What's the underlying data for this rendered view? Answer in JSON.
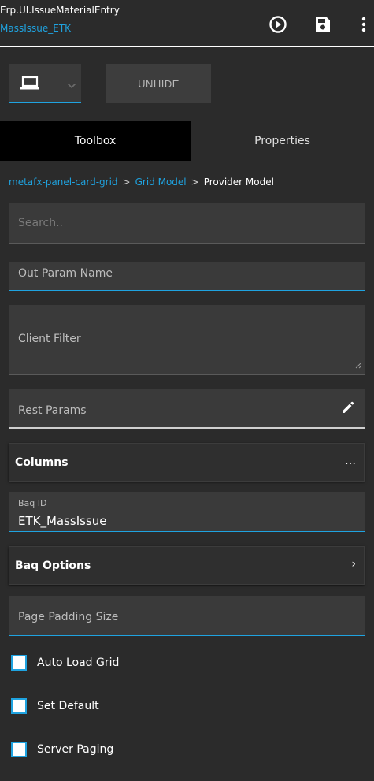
{
  "header": {
    "title": "Erp.UI.IssueMaterialEntry",
    "subtitle": "MassIssue_ETK",
    "icons": [
      "play-circle-icon",
      "save-icon",
      "more-vert-icon"
    ]
  },
  "toolbar": {
    "device": "laptop-icon",
    "unhide_label": "UNHIDE"
  },
  "tabs": [
    {
      "label": "Toolbox",
      "active": true
    },
    {
      "label": "Properties",
      "active": false
    }
  ],
  "breadcrumb": {
    "items": [
      "metafx-panel-card-grid",
      "Grid Model",
      "Provider Model"
    ],
    "separator": ">"
  },
  "search": {
    "placeholder": "Search.."
  },
  "fields": {
    "out_param_name": "Out Param Name",
    "client_filter": "Client Filter",
    "rest_params": "Rest Params",
    "page_padding_size": "Page Padding Size"
  },
  "sections": {
    "columns": {
      "label": "Columns",
      "trail": "…"
    },
    "baq_options": {
      "label": "Baq Options",
      "trail": "›"
    }
  },
  "baq_id": {
    "label": "Baq ID",
    "value": "ETK_MassIssue"
  },
  "checkboxes": [
    {
      "label": "Auto Load Grid",
      "checked": false
    },
    {
      "label": "Set Default",
      "checked": false
    },
    {
      "label": "Server Paging",
      "checked": false
    }
  ],
  "colors": {
    "accent": "#1fa3e0",
    "background": "#2b2b2b",
    "field": "#3a3a3a"
  }
}
